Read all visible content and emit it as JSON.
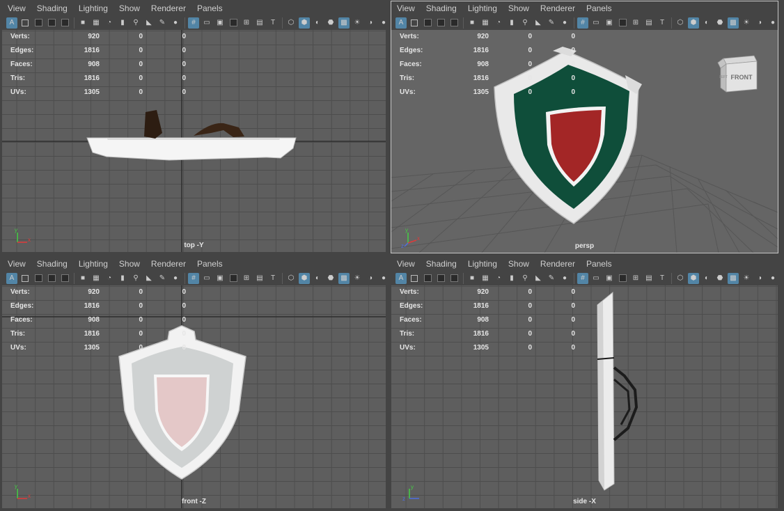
{
  "menu": [
    "View",
    "Shading",
    "Lighting",
    "Show",
    "Renderer",
    "Panels"
  ],
  "hud_rows": [
    {
      "label": "Verts:",
      "value": "920",
      "a": "0",
      "b": "0"
    },
    {
      "label": "Edges:",
      "value": "1816",
      "a": "0",
      "b": "0"
    },
    {
      "label": "Faces:",
      "value": "908",
      "a": "0",
      "b": "0"
    },
    {
      "label": "Tris:",
      "value": "1816",
      "a": "0",
      "b": "0"
    },
    {
      "label": "UVs:",
      "value": "1305",
      "a": "0",
      "b": "0"
    }
  ],
  "viewports": [
    {
      "camera": "top -Y"
    },
    {
      "camera": "persp",
      "viewcube": "FRONT",
      "viewcube_side": "LEFT"
    },
    {
      "camera": "front -Z"
    },
    {
      "camera": "side -X"
    }
  ],
  "axes": {
    "x": "x",
    "y": "y",
    "z": "z"
  },
  "colors": {
    "accent": "#5285a6",
    "shield_green": "#0f4e3a",
    "shield_red": "#a32626",
    "rim": "#ececec",
    "axis_x": "#e03a3a",
    "axis_y": "#45d045",
    "axis_z": "#4e6ee0"
  }
}
